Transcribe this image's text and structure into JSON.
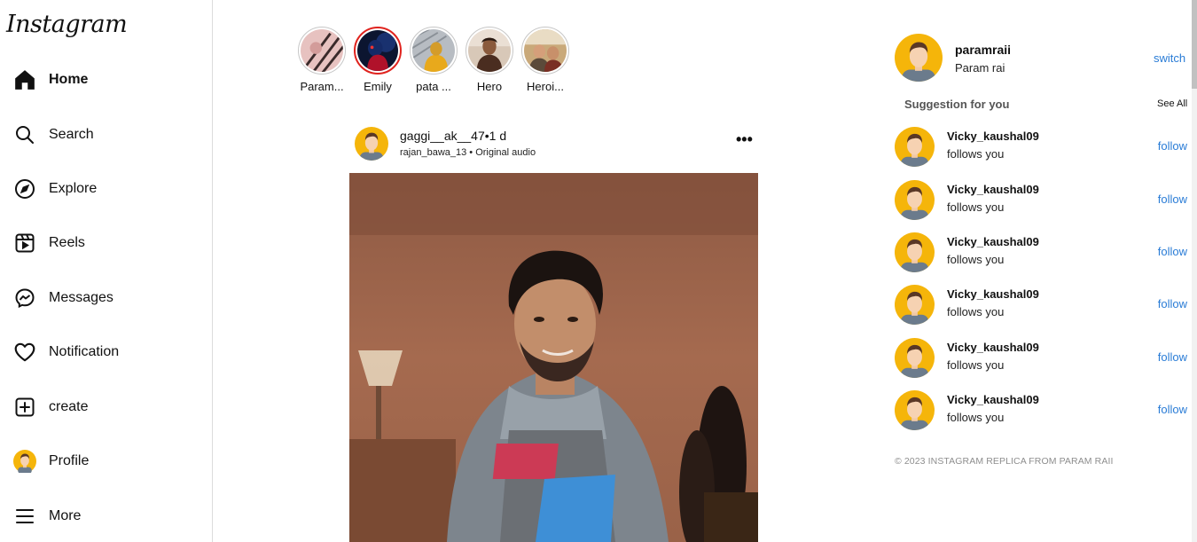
{
  "logo": "Instagram",
  "nav": [
    {
      "label": "Home",
      "icon": "home-icon"
    },
    {
      "label": "Search",
      "icon": "search-icon"
    },
    {
      "label": "Explore",
      "icon": "compass-icon"
    },
    {
      "label": "Reels",
      "icon": "reels-icon"
    },
    {
      "label": "Messages",
      "icon": "messenger-icon"
    },
    {
      "label": "Notification",
      "icon": "heart-icon"
    },
    {
      "label": "create",
      "icon": "plus-square-icon"
    },
    {
      "label": "Profile",
      "icon": "profile-avatar-icon"
    },
    {
      "label": "More",
      "icon": "menu-icon"
    }
  ],
  "stories": [
    {
      "name": "Param..."
    },
    {
      "name": "Emily"
    },
    {
      "name": "pata ..."
    },
    {
      "name": "Hero"
    },
    {
      "name": "Heroi..."
    }
  ],
  "post": {
    "user_line": "gaggi__ak__47•1 d",
    "sub_line": "rajan_bawa_13 • Original audio",
    "more": "•••"
  },
  "me": {
    "username": "paramraii",
    "name": "Param rai",
    "switch": "switch"
  },
  "suggestions": {
    "title": "Suggestion for you",
    "see_all": "See All",
    "items": [
      {
        "username": "Vicky_kaushal09",
        "status": "follows you",
        "action": "follow"
      },
      {
        "username": "Vicky_kaushal09",
        "status": "follows you",
        "action": "follow"
      },
      {
        "username": "Vicky_kaushal09",
        "status": "follows you",
        "action": "follow"
      },
      {
        "username": "Vicky_kaushal09",
        "status": "follows you",
        "action": "follow"
      },
      {
        "username": "Vicky_kaushal09",
        "status": "follows you",
        "action": "follow"
      },
      {
        "username": "Vicky_kaushal09",
        "status": "follows you",
        "action": "follow"
      }
    ]
  },
  "copyright": "© 2023 INSTAGRAM REPLICA FROM PARAM RAII",
  "colors": {
    "accent": "#2a7cd6",
    "story_ring_active": "#e0231e",
    "avatar_bg": "#f5b50a"
  }
}
